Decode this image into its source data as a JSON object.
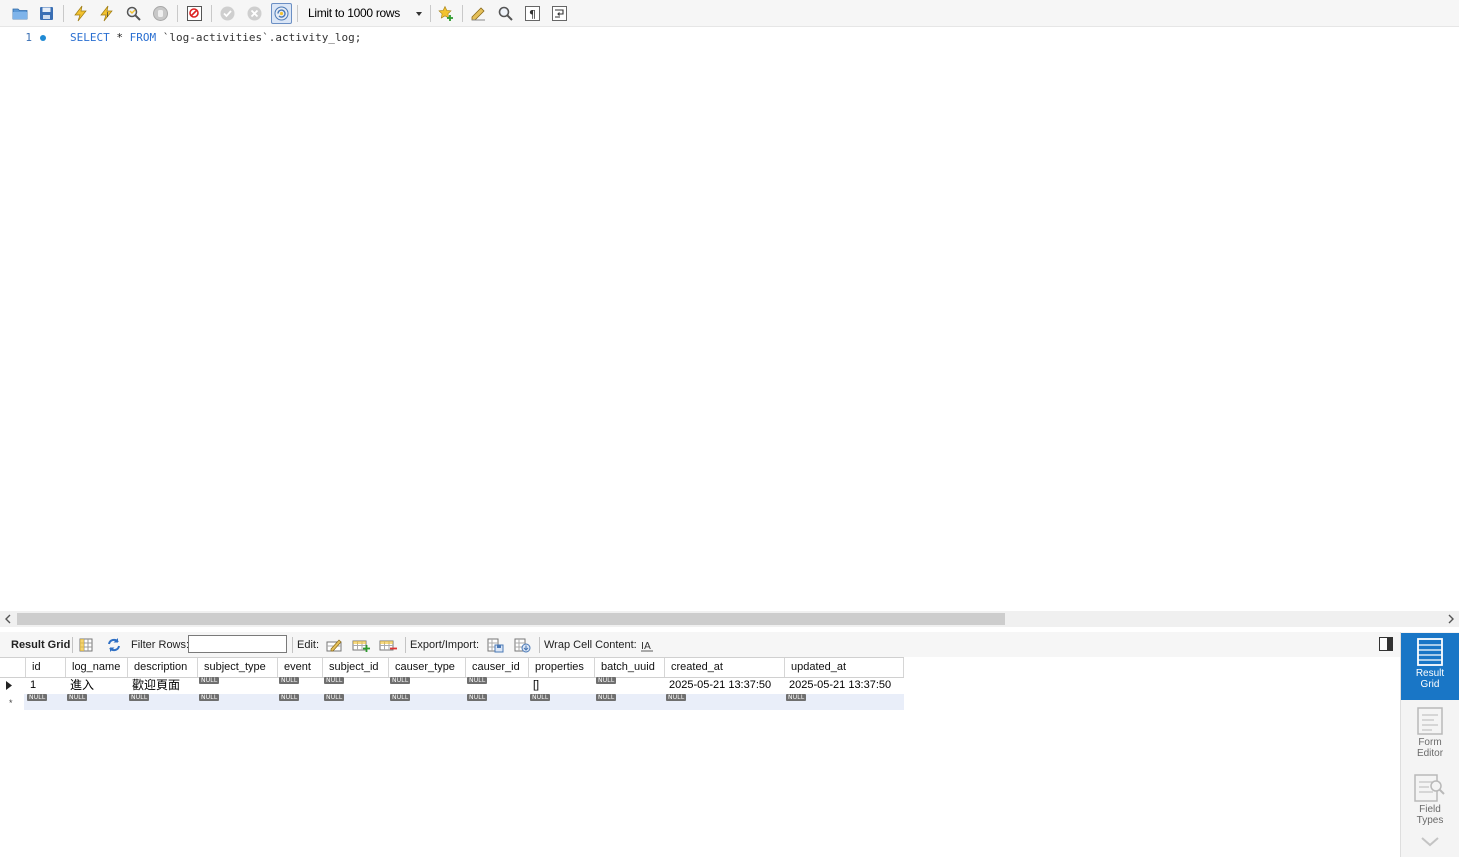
{
  "toolbar": {
    "buttons": [
      {
        "name": "open-file-icon"
      },
      {
        "name": "save-icon"
      },
      {
        "name": "execute-icon"
      },
      {
        "name": "execute-current-icon"
      },
      {
        "name": "explain-icon"
      },
      {
        "name": "stop-icon"
      },
      {
        "name": "toggle-error-icon"
      },
      {
        "name": "commit-icon"
      },
      {
        "name": "rollback-icon"
      },
      {
        "name": "autocommit-icon"
      },
      {
        "name": "add-snippet-icon"
      },
      {
        "name": "beautify-icon"
      },
      {
        "name": "find-icon"
      },
      {
        "name": "invisible-chars-icon"
      },
      {
        "name": "wrap-lines-icon"
      }
    ],
    "limit_label": "Limit to 1000 rows"
  },
  "editor": {
    "line_number": "1",
    "sql_keyword_select": "SELECT",
    "sql_star": " * ",
    "sql_keyword_from": "FROM",
    "sql_rest": " `log-activities`.activity_log;"
  },
  "result_toolbar": {
    "result_grid_label": "Result Grid",
    "filter_rows_label": "Filter Rows:",
    "filter_value": "",
    "edit_label": "Edit:",
    "export_import_label": "Export/Import:",
    "wrap_label": "Wrap Cell Content:"
  },
  "grid": {
    "null_text": "NULL",
    "columns": [
      "id",
      "log_name",
      "description",
      "subject_type",
      "event",
      "subject_id",
      "causer_type",
      "causer_id",
      "properties",
      "batch_uuid",
      "created_at",
      "updated_at"
    ],
    "rows": [
      {
        "id": "1",
        "log_name": "進入",
        "description": "歡迎頁面",
        "subject_type": null,
        "event": null,
        "subject_id": null,
        "causer_type": null,
        "causer_id": null,
        "properties": "[]",
        "batch_uuid": null,
        "created_at": "2025-05-21 13:37:50",
        "updated_at": "2025-05-21 13:37:50"
      }
    ],
    "new_row_marker": "*"
  },
  "side_panel": {
    "result_grid": "Result Grid",
    "form_editor": "Form Editor",
    "field_types": "Field Types"
  },
  "colors": {
    "keyword": "#2a6fd1",
    "active_panel": "#1976c6",
    "null_badge": "#6f6f6f"
  }
}
